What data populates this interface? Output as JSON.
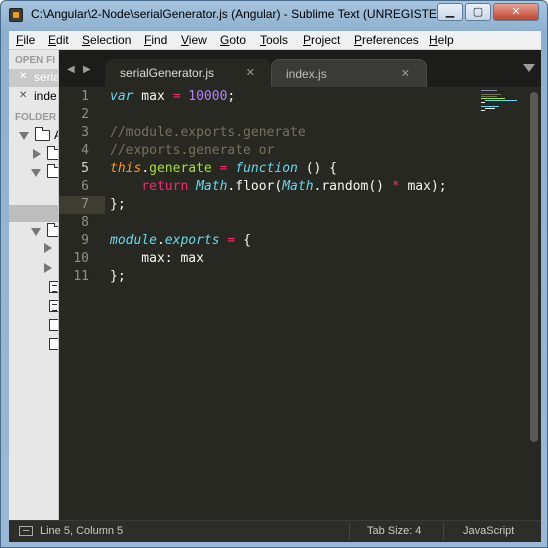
{
  "window": {
    "title": "C:\\Angular\\2-Node\\serialGenerator.js (Angular) - Sublime Text (UNREGISTE...",
    "min_label": "▁",
    "max_label": "▢",
    "close_label": "✕"
  },
  "menu": [
    "File",
    "Edit",
    "Selection",
    "Find",
    "View",
    "Goto",
    "Tools",
    "Project",
    "Preferences",
    "Help"
  ],
  "sidebar": {
    "open_files_heading": "OPEN FI",
    "open_files": [
      {
        "name": "serial",
        "active": true
      },
      {
        "name": "inde",
        "active": false
      }
    ],
    "folders_heading": "FOLDER",
    "root_folder_label": "A"
  },
  "tabs": [
    {
      "label": "serialGenerator.js",
      "active": true,
      "close": "✕"
    },
    {
      "label": "index.js",
      "active": false,
      "close": "✕"
    }
  ],
  "nav": {
    "prev": "◀",
    "next": "▶"
  },
  "editor": {
    "line_numbers": [
      "1",
      "2",
      "3",
      "4",
      "5",
      "6",
      "7",
      "8",
      "9",
      "10",
      "11"
    ],
    "current_line": 5
  },
  "code_tokens": {
    "l1_var": "var",
    "l1_name": " max ",
    "l1_eq": "=",
    "l1_num": " 10000",
    "l1_end": ";",
    "l3": "//module.exports.generate",
    "l4": "//exports.generate or",
    "l5_this": "this",
    "l5_dot": ".",
    "l5_gen": "generate",
    "l5_eq": " = ",
    "l5_fn": "function",
    "l5_rest": " () {",
    "l6_indent": "    ",
    "l6_return": "return",
    "l6_sp": " ",
    "l6_math1": "Math",
    "l6_floor": ".floor(",
    "l6_math2": "Math",
    "l6_random": ".random() ",
    "l6_mul": "*",
    "l6_end": " max);",
    "l7": "};",
    "l9_module": "module",
    "l9_dot": ".",
    "l9_exports": "exports",
    "l9_eq": " = ",
    "l9_brace": "{",
    "l10": "    max: max",
    "l11": "};"
  },
  "status": {
    "position": "Line 5, Column 5",
    "tab_size": "Tab Size: 4",
    "syntax": "JavaScript"
  },
  "colors": {
    "editor_bg": "#272822",
    "keyword": "#66d9ef",
    "operator": "#f92672",
    "number": "#ae81ff",
    "comment": "#75715e",
    "function": "#a6e22e",
    "this": "#fd971f"
  }
}
